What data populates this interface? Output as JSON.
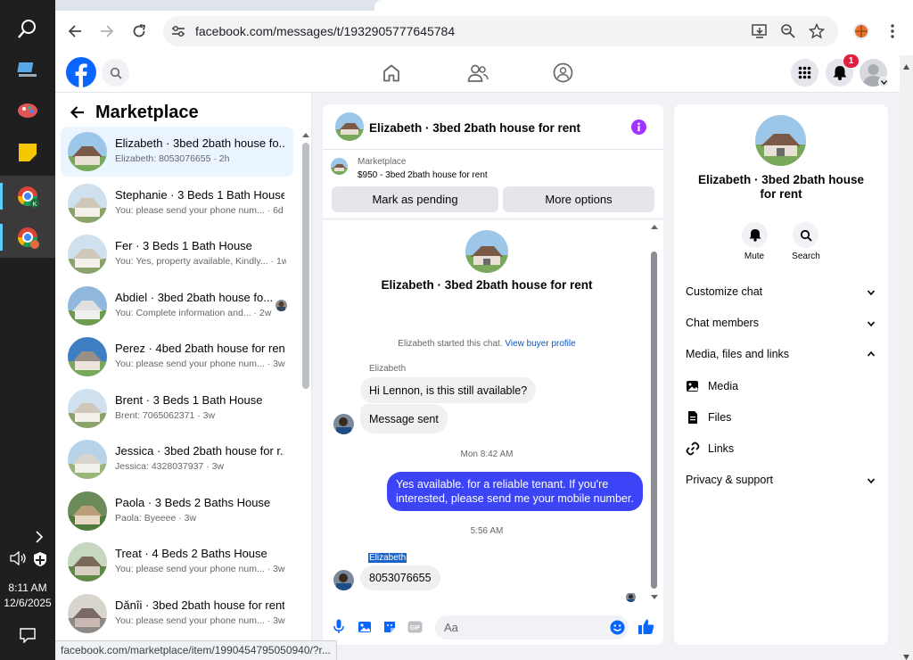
{
  "taskbar": {
    "time": "8:11 AM",
    "date": "12/6/2025"
  },
  "browser": {
    "url": "facebook.com/messages/t/1932905777645784",
    "status_url": "facebook.com/marketplace/item/1990454795050940/?r..."
  },
  "fb": {
    "notification_count": "1"
  },
  "left": {
    "title": "Marketplace",
    "conversations": [
      {
        "name": "Elizabeth · 3bed 2bath house fo...",
        "preview": "Elizabeth: 8053076655 · 2h"
      },
      {
        "name": "Stephanie · 3 Beds 1 Bath House",
        "preview": "You: please send your phone num... · 6d"
      },
      {
        "name": "Fer · 3 Beds 1 Bath House",
        "preview": "You: Yes, property available, Kindly... · 1w"
      },
      {
        "name": "Abdiel · 3bed 2bath house fo...",
        "preview": "You: Complete information and... · 2w"
      },
      {
        "name": "Perez · 4bed 2bath house for rent",
        "preview": "You: please send your phone num... · 3w"
      },
      {
        "name": "Brent · 3 Beds 1 Bath House",
        "preview": "Brent: 7065062371 · 3w"
      },
      {
        "name": "Jessica · 3bed 2bath house for r...",
        "preview": "Jessica: 4328037937 · 3w"
      },
      {
        "name": "Paola · 3 Beds 2 Baths House",
        "preview": "Paola: Byeeee · 3w"
      },
      {
        "name": "Treat · 4 Beds 2 Baths House",
        "preview": "You: please send your phone num... · 3w"
      },
      {
        "name": "Dǎnîi · 3bed 2bath house for rent",
        "preview": "You: please send your phone num... · 3w"
      }
    ]
  },
  "chat": {
    "title": "Elizabeth · 3bed 2bath house for rent",
    "listing_source": "Marketplace",
    "listing": "$950 - 3bed 2bath house for rent",
    "mark_pending": "Mark as pending",
    "more_options": "More options",
    "intro_title": "Elizabeth · 3bed 2bath house for rent",
    "started": "Elizabeth started this chat.",
    "view_profile": "View buyer profile",
    "sender1": "Elizabeth",
    "msg1": "Hi Lennon, is this still available?",
    "msg2": "Message sent",
    "time1": "Mon 8:42 AM",
    "msg3": "Yes available. for a reliable tenant. If you're interested, please send me your mobile number.",
    "time2": "5:56 AM",
    "sender2": "Elizabeth",
    "msg4": "8053076655",
    "input_placeholder": "Aa"
  },
  "right": {
    "title": "Elizabeth · 3bed 2bath house for rent",
    "mute": "Mute",
    "search": "Search",
    "customize": "Customize chat",
    "members": "Chat members",
    "media_files": "Media, files and links",
    "media": "Media",
    "files": "Files",
    "links": "Links",
    "privacy": "Privacy & support"
  },
  "colors": {
    "fb_blue": "#0866ff",
    "messenger_bubble": "#3b44f6",
    "notification_red": "#e41e3f"
  }
}
